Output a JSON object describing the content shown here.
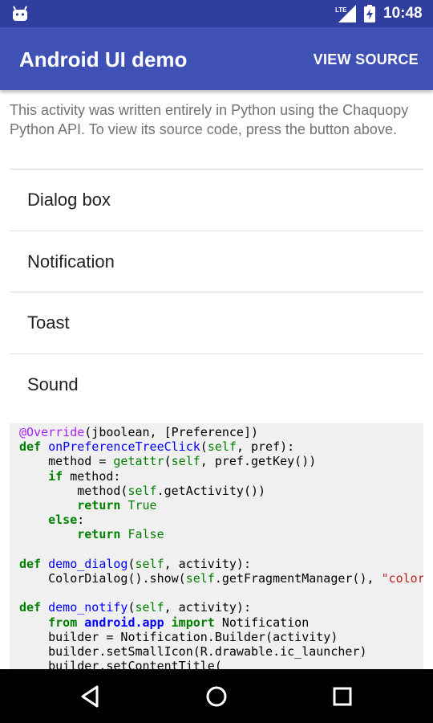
{
  "status_bar": {
    "time": "10:48",
    "network_label": "LTE",
    "icons": [
      "android-icon",
      "lte-signal-icon",
      "battery-icon"
    ]
  },
  "app_bar": {
    "title": "Android UI demo",
    "action_label": "VIEW SOURCE"
  },
  "intro_text": "This activity was written entirely in Python using the Chaquopy Python API. To view its source code, press the button above.",
  "preferences": [
    {
      "label": "Dialog box"
    },
    {
      "label": "Notification"
    },
    {
      "label": "Toast"
    },
    {
      "label": "Sound"
    }
  ],
  "source_code_lines": [
    "@Override(jboolean, [Preference])",
    "def onPreferenceTreeClick(self, pref):",
    "    method = getattr(self, pref.getKey())",
    "    if method:",
    "        method(self.getActivity())",
    "        return True",
    "    else:",
    "        return False",
    "",
    "def demo_dialog(self, activity):",
    "    ColorDialog().show(self.getFragmentManager(), \"color\")",
    "",
    "def demo_notify(self, activity):",
    "    from android.app import Notification",
    "    builder = Notification.Builder(activity)",
    "    builder.setSmallIcon(R.drawable.ic_launcher)",
    "    builder.setContentTitle("
  ],
  "nav_bar": {
    "icons": [
      "back-icon",
      "home-icon",
      "recents-icon"
    ]
  },
  "colors": {
    "status_bar": "#303f9f",
    "app_bar": "#3f51b5",
    "code_background": "#f0f0f0"
  }
}
